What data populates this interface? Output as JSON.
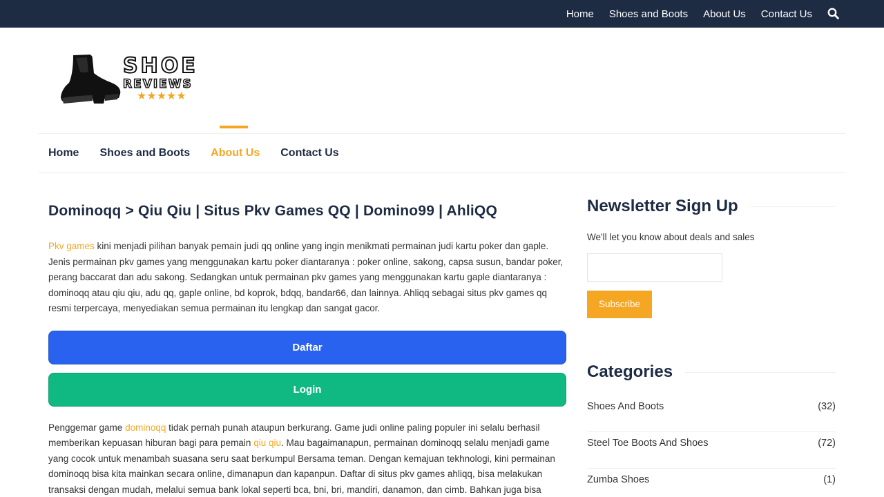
{
  "topnav": {
    "items": [
      "Home",
      "Shoes and Boots",
      "About Us",
      "Contact Us"
    ],
    "search_icon": "search-icon"
  },
  "logo": {
    "line1": "SHOE",
    "line2": "REVIEWS",
    "stars": 5
  },
  "mainnav": {
    "items": [
      "Home",
      "Shoes and Boots",
      "About Us",
      "Contact Us"
    ],
    "active": "About Us"
  },
  "article": {
    "title": "Dominoqq > Qiu Qiu | Situs Pkv Games QQ | Domino99 | AhliQQ",
    "p1_link": "Pkv games",
    "p1_text": " kini menjadi pilihan banyak pemain judi qq online yang ingin menikmati permainan judi kartu poker dan gaple. Jenis permainan pkv games yang menggunakan kartu poker diantaranya : poker online, sakong, capsa susun, bandar poker, perang baccarat dan adu sakong. Sedangkan untuk permainan pkv games yang menggunakan kartu gaple diantaranya : dominoqq atau qiu qiu, adu qq, gaple online, bd koprok, bdqq, bandar66, dan lainnya. Ahliqq sebagai situs pkv games qq resmi terpercaya, menyediakan semua permainan itu lengkap dan sangat gacor.",
    "btn_daftar": "Daftar",
    "btn_login": "Login",
    "p2_a": "Penggemar game ",
    "p2_link1": "dominoqq",
    "p2_b": " tidak pernah punah ataupun berkurang. Game judi online paling populer ini selalu berhasil memberikan kepuasan hiburan bagi para pemain ",
    "p2_link2": "qiu qiu",
    "p2_c": ". Mau bagaimanapun, permainan dominoqq selalu menjadi game yang cocok untuk menambah suasana seru saat berkumpul Bersama teman. Dengan kemajuan tekhnologi, kini permainan dominoqq bisa kita mainkan secara online, dimanapun dan kapanpun. Daftar di situs pkv games ahliqq, bisa melakukan transaksi dengan mudah, melalui semua bank lokal seperti bca, bni, bri, mandiri, danamon, dan cimb. Bahkan juga bisa"
  },
  "newsletter": {
    "title": "Newsletter Sign Up",
    "desc": "We'll let you know about deals and sales",
    "input_value": "",
    "button": "Subscribe"
  },
  "categories": {
    "title": "Categories",
    "items": [
      {
        "name": "Shoes And Boots",
        "count": "(32)"
      },
      {
        "name": "Steel Toe Boots And Shoes",
        "count": "(72)"
      },
      {
        "name": "Zumba Shoes",
        "count": "(1)"
      }
    ]
  },
  "colors": {
    "topbar": "#1d2b43",
    "accent": "#f5a623",
    "daftar": "#2962ef",
    "login": "#10b981"
  }
}
